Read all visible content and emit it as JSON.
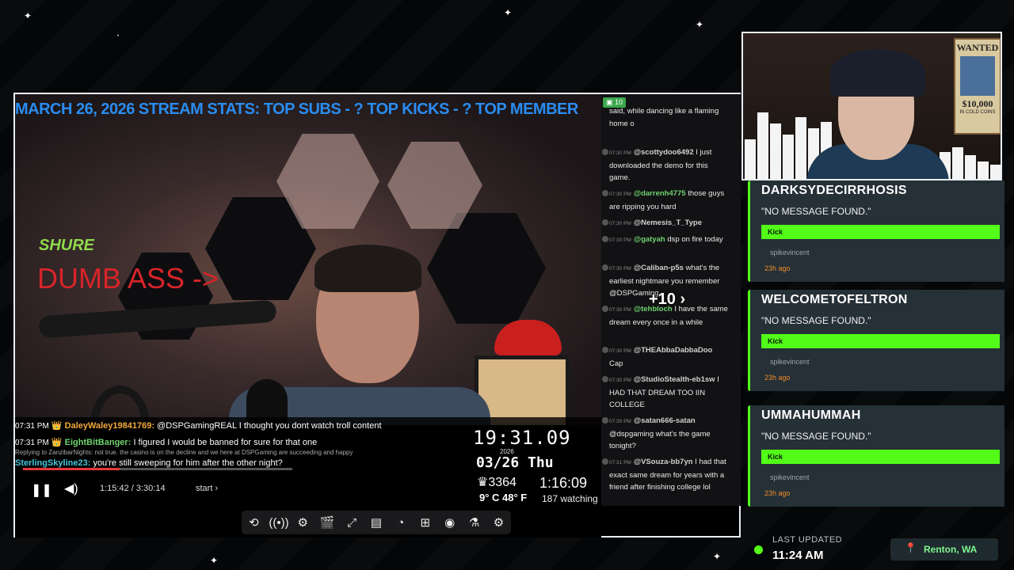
{
  "ticker": {
    "text": "MARCH 26, 2026     STREAM STATS:    TOP SUBS - ?    TOP KICKS -  ?    TOP MEMBER"
  },
  "overlay": {
    "dumb_text": "DUMB ASS ->",
    "mic_brand": "SHURE"
  },
  "video_chat": [
    {
      "time": "07:31 PM",
      "user": "DaleyWaley19841769:",
      "text": "@DSPGamingREAL I thought you dont watch troll content",
      "color": "#f2a93b"
    },
    {
      "time": "07:31 PM",
      "user": "EightBitBanger:",
      "text": "I figured I would be banned for sure for that one",
      "color": "#6fd36f"
    },
    {
      "time": "07:31 PM",
      "user": "SterlingSkyline23:",
      "text": "you're still sweeping for him after the other night?",
      "color": "#44c6d8"
    }
  ],
  "reply_note": "Replying to ZanzibarNights: not true. the casino is on the decline and we here at DSPGaming are succeeding and happy",
  "clock": {
    "time": "19:31.09",
    "year": "2026",
    "date": "03/26 Thu"
  },
  "stats": {
    "viewers": "3364",
    "temp": "9° C 48° F",
    "uptime": "1:16:09",
    "watching": "187 watching"
  },
  "player": {
    "time": "1:15:42 / 3:30:14",
    "start": "start",
    "progress": 0.36,
    "play_icon": "pause-icon",
    "volume_icon": "volume-icon"
  },
  "chat": {
    "count": "10",
    "plus": "+10",
    "messages": [
      {
        "time": "",
        "user": "",
        "text": "said, while dancing like a flaming home o",
        "color": "#eaeaea"
      },
      {
        "time": "07:30 PM",
        "user": "@scottydoo6492",
        "text": "I just downloaded the demo for this game.",
        "color": "#d0d0d0"
      },
      {
        "time": "07:30 PM",
        "user": "@darrenh4775",
        "text": "those guys are ripping you hard",
        "color": "#6fd36f"
      },
      {
        "time": "07:30 PM",
        "user": "@Nemesis_T_Type",
        "text": "",
        "color": "#d0d0d0"
      },
      {
        "time": "07:30 PM",
        "user": "@gatyah",
        "text": "dsp on fire today",
        "color": "#6fd36f"
      },
      {
        "time": "07:30 PM",
        "user": "@Caliban-p5s",
        "text": "what's the earliest nightmare you remember @DSPGaming",
        "color": "#d0d0d0"
      },
      {
        "time": "07:30 PM",
        "user": "@tehbloch",
        "text": "I have the same dream every once in a while",
        "color": "#6fd36f"
      },
      {
        "time": "07:30 PM",
        "user": "@THEAbbaDabbaDoo",
        "text": "Cap",
        "color": "#d0d0d0"
      },
      {
        "time": "07:30 PM",
        "user": "@StudioStealth-eb1sw",
        "text": "I HAD THAT DREAM TOO IIN COLLEGE",
        "color": "#d0d0d0"
      },
      {
        "time": "07:30 PM",
        "user": "@satan666-satan",
        "text": "@dspgaming what's the game tonight?",
        "color": "#d0d0d0"
      },
      {
        "time": "07:31 PM",
        "user": "@VSouza-bb7yn",
        "text": "I had that exact same dream for years with a friend after finishing college lol",
        "color": "#d0d0d0"
      }
    ]
  },
  "toolbar": [
    "repeat-icon",
    "broadcast-icon",
    "gear-video-icon",
    "clapper-icon",
    "resize-icon",
    "clip-icon",
    "speed-icon",
    "add-icon",
    "camera-icon",
    "flask-icon",
    "settings-icon"
  ],
  "wanted": {
    "title": "WANTED",
    "amount": "$10,000",
    "sub": "IN COLD COINS"
  },
  "kicks": [
    {
      "name": "DARKSYDECIRRHOSIS",
      "message": "\"NO MESSAGE FOUND.\"",
      "badge": "Kick",
      "by": "spikevincent",
      "ago": "23h ago"
    },
    {
      "name": "WELCOMETOFELTRON",
      "message": "\"NO MESSAGE FOUND.\"",
      "badge": "Kick",
      "by": "spikevincent",
      "ago": "23h ago"
    },
    {
      "name": "UMMAHUMMAH",
      "message": "\"NO MESSAGE FOUND.\"",
      "badge": "Kick",
      "by": "spikevincent",
      "ago": "23h ago"
    }
  ],
  "last_updated": {
    "label": "LAST UPDATED",
    "value": "11:24 AM"
  },
  "location": "Renton, WA",
  "colors": {
    "kick_green": "#53fc18",
    "ticker_blue": "#2a8cf0",
    "alert_red": "#d8242a"
  }
}
